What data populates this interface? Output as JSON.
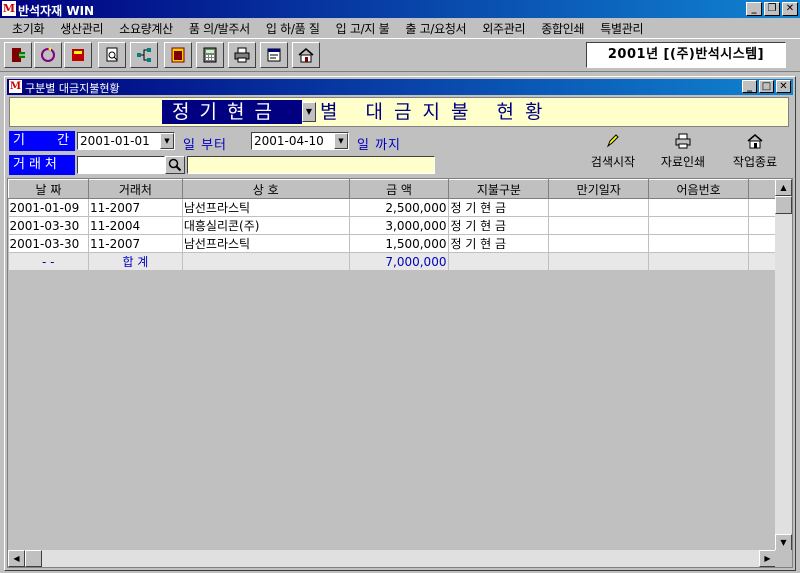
{
  "app": {
    "title": "반석자재 WIN",
    "logo": "M"
  },
  "menu": [
    "초기화",
    "생산관리",
    "소요량계산",
    "품 의/발주서",
    "입 하/품 질",
    "입 고/지 불",
    "출 고/요청서",
    "외주관리",
    "종합인쇄",
    "특별관리"
  ],
  "toolbar": {
    "icons": [
      "exit-icon",
      "refresh-icon",
      "book-icon",
      "document-search-icon",
      "network-icon",
      "calendar-icon",
      "calculator-icon",
      "printer-icon",
      "notepad-icon",
      "home-icon"
    ],
    "year_label": "2001년 [(주)반석시스템]"
  },
  "child": {
    "title": "구분별 대금지불현황",
    "banner_select": "정기현금",
    "banner_text": "별 대금지불 현황"
  },
  "filters": {
    "period_label": "기 간",
    "from_date": "2001-01-01",
    "from_suffix": "일 부터",
    "to_date": "2001-04-10",
    "to_suffix": "일 까지",
    "customer_label": "거래처"
  },
  "actions": {
    "search": "검색시작",
    "print": "자료인쇄",
    "close": "작업종료"
  },
  "table": {
    "headers": [
      "날 짜",
      "거래처",
      "상 호",
      "금 액",
      "지불구분",
      "만기일자",
      "어음번호"
    ],
    "rows": [
      [
        "2001-01-09",
        "11-2007",
        "남선프라스틱",
        "2,500,000",
        "정 기 현 금",
        "",
        ""
      ],
      [
        "2001-03-30",
        "11-2004",
        "대흥실리콘(주)",
        "3,000,000",
        "정 기 현 금",
        "",
        ""
      ],
      [
        "2001-03-30",
        "11-2007",
        "남선프라스틱",
        "1,500,000",
        "정 기 현 금",
        "",
        ""
      ]
    ],
    "total": {
      "date": "- -",
      "label": "합 계",
      "amount": "7,000,000"
    }
  }
}
